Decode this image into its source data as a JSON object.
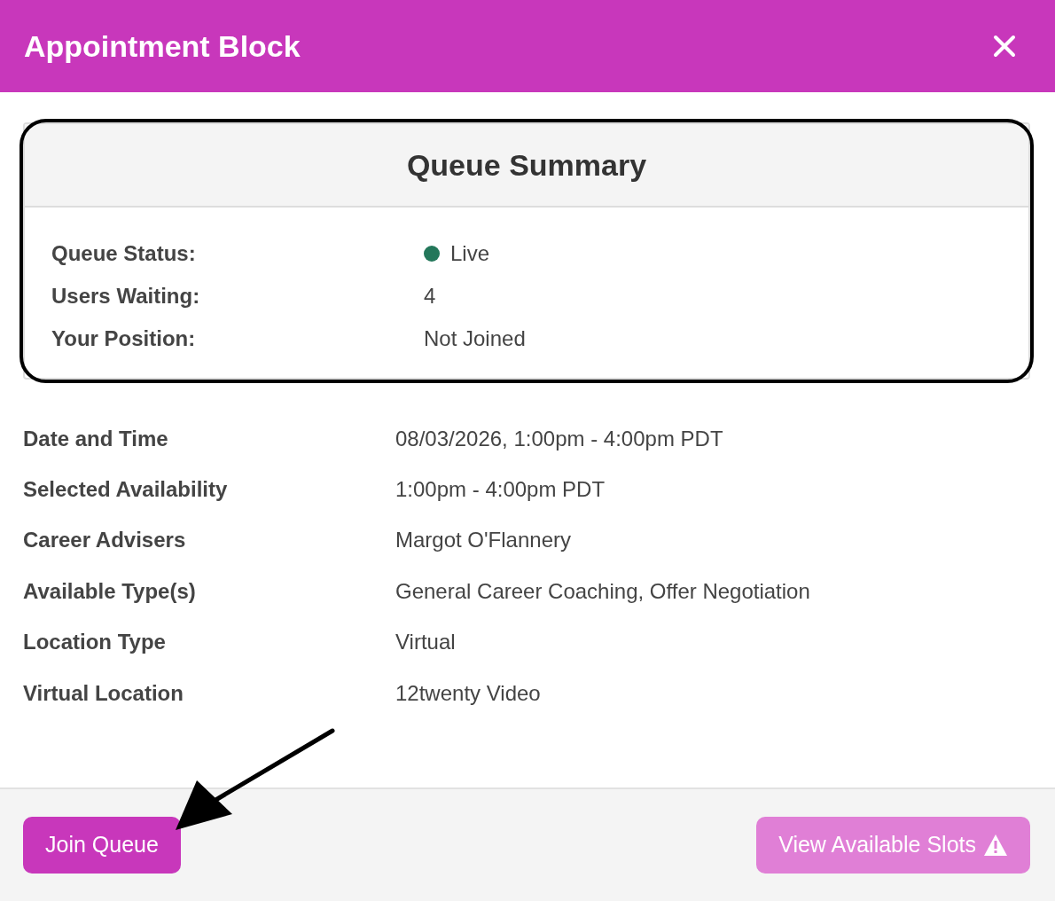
{
  "modal": {
    "title": "Appointment Block"
  },
  "queue_summary": {
    "title": "Queue Summary",
    "highlighted": true,
    "rows": [
      {
        "label": "Queue Status:",
        "value": "Live",
        "kind": "status",
        "live": true
      },
      {
        "label": "Users Waiting:",
        "value": "4",
        "kind": "text"
      },
      {
        "label": "Your Position:",
        "value": "Not Joined",
        "kind": "text"
      }
    ]
  },
  "details": [
    {
      "label": "Date and Time",
      "value": "08/03/2026, 1:00pm - 4:00pm PDT"
    },
    {
      "label": "Selected Availability",
      "value": "1:00pm - 4:00pm PDT"
    },
    {
      "label": "Career Advisers",
      "value": "Margot O'Flannery"
    },
    {
      "label": "Available Type(s)",
      "value": "General Career Coaching, Offer Negotiation"
    },
    {
      "label": "Location Type",
      "value": "Virtual"
    },
    {
      "label": "Virtual Location",
      "value": "12twenty Video"
    }
  ],
  "buttons": [
    {
      "label": "Join Queue",
      "disabled": false,
      "warning": false,
      "pointed_at": true
    },
    {
      "label": "View Available Slots",
      "disabled": true,
      "warning": true,
      "pointed_at": false
    }
  ]
}
